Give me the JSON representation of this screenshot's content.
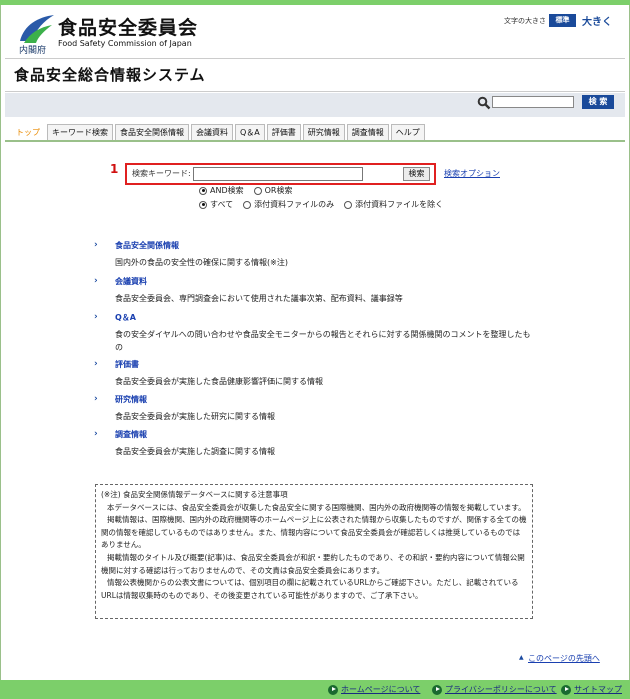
{
  "header": {
    "org_name_jp": "食品安全委員会",
    "org_name_en": "Food Safety Commission of Japan",
    "cabinet_office": "内閣府",
    "font_size_label": "文字の大きさ",
    "font_size_standard": "標準",
    "font_size_large": "大きく",
    "system_title": "食品安全総合情報システム",
    "search_button": "検 索"
  },
  "tabs": [
    "トップ",
    "キーワード検索",
    "食品安全関係情報",
    "会議資料",
    "Q＆A",
    "評価書",
    "研究情報",
    "調査情報",
    "ヘルプ"
  ],
  "keyword_search": {
    "marker": "1",
    "label": "検索キーワード:",
    "button": "検索",
    "option_link": "検索オプション",
    "mode_options": [
      "AND検索",
      "OR検索"
    ],
    "scope_options": [
      "すべて",
      "添付資料ファイルのみ",
      "添付資料ファイルを除く"
    ]
  },
  "items": [
    {
      "name": "食品安全関係情報",
      "desc": "国内外の食品の安全性の確保に関する情報(※注)"
    },
    {
      "name": "会議資料",
      "desc": "食品安全委員会、専門調査会において使用された議事次第、配布資料、議事録等"
    },
    {
      "name": "Q＆A",
      "desc": "食の安全ダイヤルへの問い合わせや食品安全モニターからの報告とそれらに対する関係機関のコメントを整理したもの"
    },
    {
      "name": "評価書",
      "desc": "食品安全委員会が実施した食品健康影響評価に関する情報"
    },
    {
      "name": "研究情報",
      "desc": "食品安全委員会が実施した研究に関する情報"
    },
    {
      "name": "調査情報",
      "desc": "食品安全委員会が実施した調査に関する情報"
    }
  ],
  "note": {
    "title": "(※注) 食品安全関係情報データベースに関する注意事項",
    "p1": "本データベースには、食品安全委員会が収集した食品安全に関する国際機関、国内外の政府機関等の情報を掲載しています。",
    "p2": "掲載情報は、国際機関、国内外の政府機関等のホームページ上に公表された情報から収集したものですが、関係する全ての機関の情報を確認しているものではありません。また、情報内容について食品安全委員会が確認若しくは推奨しているものではありません。",
    "p3": "掲載情報のタイトル及び概要(記事)は、食品安全委員会が和訳・要約したものであり、その和訳・要約内容について情報公開機関に対する確認は行っておりませんので、その文責は食品安全委員会にあります。",
    "p4": "情報公表機関からの公表文書については、個別項目の欄に記載されているURLからご確認下さい。ただし、記載されているURLは情報収集時のものであり、その後変更されている可能性がありますので、ご了承下さい。"
  },
  "page_top": "このページの先頭へ",
  "footer": [
    "ホームページについて",
    "プライバシーポリシーについて",
    "サイトマップ"
  ],
  "colors": {
    "accent_green": "#7ccf6a",
    "brand_blue": "#1a4a9a",
    "highlight_red": "#e02020"
  }
}
